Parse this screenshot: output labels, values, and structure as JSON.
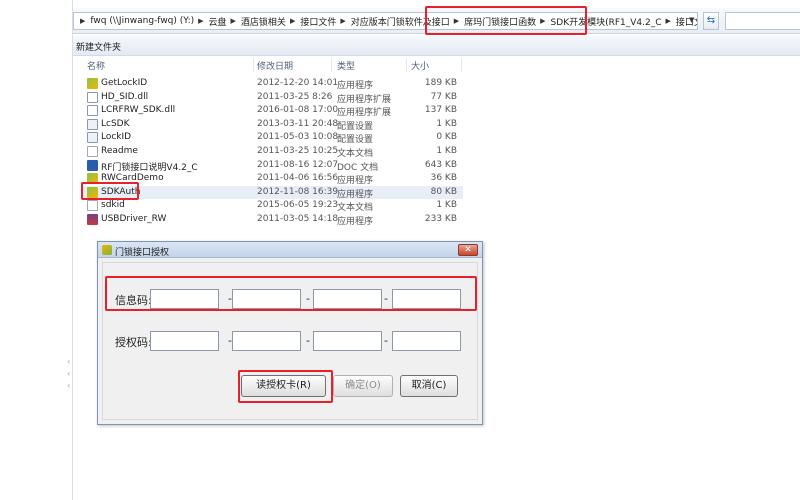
{
  "address_bar": {
    "crumbs": [
      "fwq (\\\\Jinwang-fwq) (Y:)",
      "云盘",
      "酒店锁相关",
      "接口文件",
      "对应版本门锁软件及接口",
      "席玛门锁接口函数",
      "SDK开发模块(RF1_V4.2_C",
      "接口文件"
    ]
  },
  "toolbar": {
    "new_folder_label": "新建文件夹"
  },
  "columns": {
    "name": "名称",
    "date": "修改日期",
    "type": "类型",
    "size": "大小"
  },
  "files": [
    {
      "name": "GetLockID",
      "date": "2012-12-20 14:01",
      "type": "应用程序",
      "size": "189 KB",
      "icon": "exe"
    },
    {
      "name": "HD_SID.dll",
      "date": "2011-03-25 8:26",
      "type": "应用程序扩展",
      "size": "77 KB",
      "icon": "dll"
    },
    {
      "name": "LCRFRW_SDK.dll",
      "date": "2016-01-08 17:00",
      "type": "应用程序扩展",
      "size": "137 KB",
      "icon": "dll"
    },
    {
      "name": "LcSDK",
      "date": "2013-03-11 20:48",
      "type": "配置设置",
      "size": "1 KB",
      "icon": "cfg"
    },
    {
      "name": "LockID",
      "date": "2011-05-03 10:08",
      "type": "配置设置",
      "size": "0 KB",
      "icon": "cfg"
    },
    {
      "name": "Readme",
      "date": "2011-03-25 10:25",
      "type": "文本文档",
      "size": "1 KB",
      "icon": "txt"
    },
    {
      "name": "RF门锁接口说明V4.2_C",
      "date": "2011-08-16 12:07",
      "type": "DOC 文档",
      "size": "643 KB",
      "icon": "doc"
    },
    {
      "name": "RWCardDemo",
      "date": "2011-04-06 16:56",
      "type": "应用程序",
      "size": "36 KB",
      "icon": "exe"
    },
    {
      "name": "SDKAuth",
      "date": "2012-11-08 16:39",
      "type": "应用程序",
      "size": "80 KB",
      "icon": "exe"
    },
    {
      "name": "sdkid",
      "date": "2015-06-05 19:23",
      "type": "文本文档",
      "size": "1 KB",
      "icon": "txt"
    },
    {
      "name": "USBDriver_RW",
      "date": "2011-03-05 14:18",
      "type": "应用程序",
      "size": "233 KB",
      "icon": "rar"
    }
  ],
  "dialog": {
    "title": "门锁接口授权",
    "info_label": "信息码:",
    "auth_label": "授权码:",
    "dash": "-",
    "read_button": "读授权卡(R)",
    "ok_button": "确定(O)",
    "cancel_button": "取消(C)"
  }
}
